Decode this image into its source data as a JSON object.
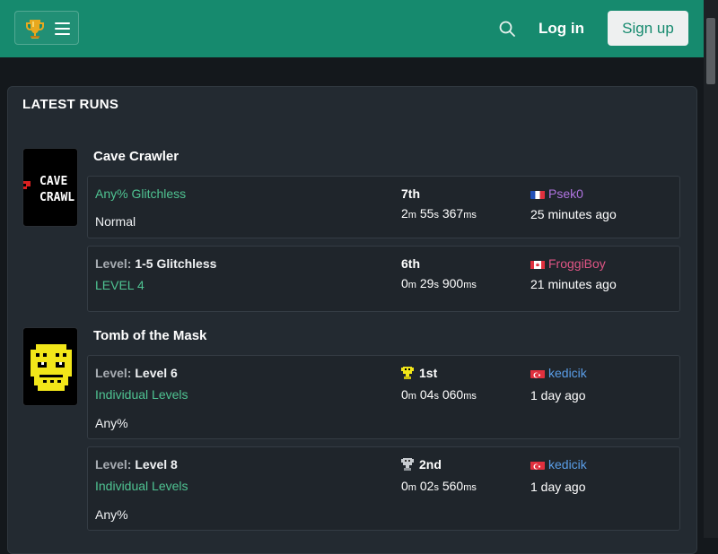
{
  "nav": {
    "login_label": "Log in",
    "signup_label": "Sign up"
  },
  "section": {
    "title": "LATEST RUNS"
  },
  "games": [
    {
      "name": "Cave Crawler",
      "cover_text": [
        "CAVE",
        "CRAWL"
      ]
    },
    {
      "name": "Tomb of the Mask"
    }
  ],
  "runs": [
    {
      "category": "Any% Glitchless",
      "subcategory": "Normal",
      "place": "7th",
      "time": {
        "m": "2",
        "s": "55",
        "ms": "367"
      },
      "player": "Psek0",
      "player_color": "#b074e0",
      "when": "25 minutes ago"
    },
    {
      "level_prefix": "Level:",
      "level": "1-5 Glitchless",
      "category": "LEVEL 4",
      "place": "6th",
      "time": {
        "m": "0",
        "s": "29",
        "ms": "900"
      },
      "player": "FroggiBoy",
      "player_color": "#e05585",
      "when": "21 minutes ago"
    },
    {
      "level_prefix": "Level:",
      "level": "Level 6",
      "category": "Individual Levels",
      "subcategory": "Any%",
      "place": "1st",
      "time": {
        "m": "0",
        "s": "04",
        "ms": "060"
      },
      "player": "kedicik",
      "player_color": "#5a9ee8",
      "when": "1 day ago"
    },
    {
      "level_prefix": "Level:",
      "level": "Level 8",
      "category": "Individual Levels",
      "subcategory": "Any%",
      "place": "2nd",
      "time": {
        "m": "0",
        "s": "02",
        "ms": "560"
      },
      "player": "kedicik",
      "player_color": "#5a9ee8",
      "when": "1 day ago"
    }
  ],
  "units": {
    "m": "m",
    "s": "s",
    "ms": "ms"
  },
  "colors": {
    "header": "#168a6e",
    "accent_green": "#4fc392",
    "card": "#232a31"
  }
}
